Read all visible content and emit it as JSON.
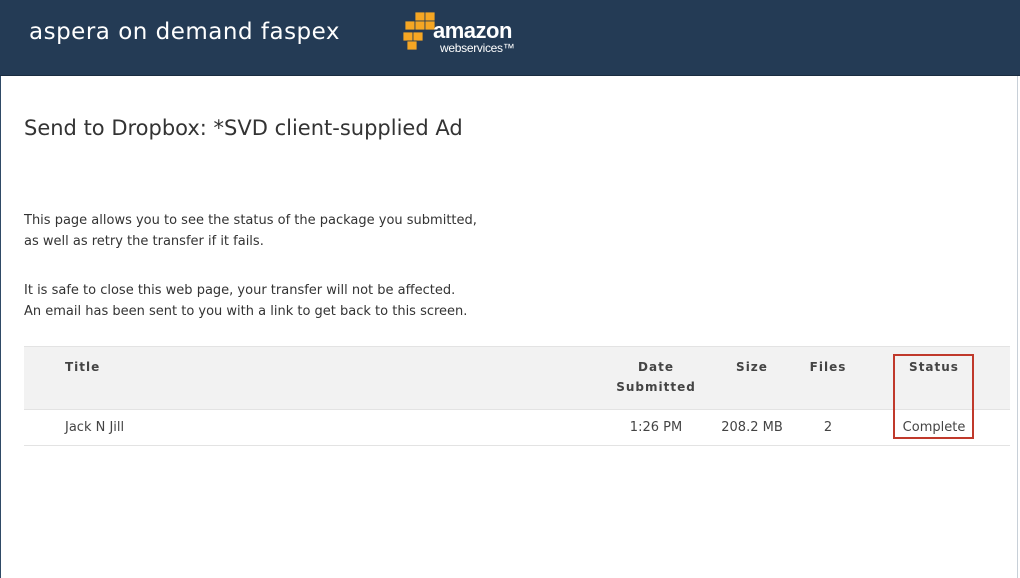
{
  "header": {
    "brand": "aspera on demand faspex",
    "partner_logo": {
      "word": "amazon",
      "sub": "webservices™",
      "cube_color": "#f5a623"
    }
  },
  "page": {
    "title": "Send to Dropbox: *SVD client-supplied Ad",
    "paragraph1": [
      "This page allows you to see the status of the package you submitted,",
      "as well as retry the transfer if it fails."
    ],
    "paragraph2": [
      "It is safe to close this web page, your transfer will not be affected.",
      "An email has been sent to you with a link to get back to this screen."
    ]
  },
  "table": {
    "columns": {
      "title": "Title",
      "date": [
        "Date",
        "Submitted"
      ],
      "size": "Size",
      "files": "Files",
      "status": "Status"
    },
    "rows": [
      {
        "title": "Jack N Jill",
        "date": "1:26 PM",
        "size": "208.2 MB",
        "files": "2",
        "status": "Complete"
      }
    ]
  },
  "colors": {
    "header_bg": "#243b55",
    "highlight": "#c0392b"
  }
}
